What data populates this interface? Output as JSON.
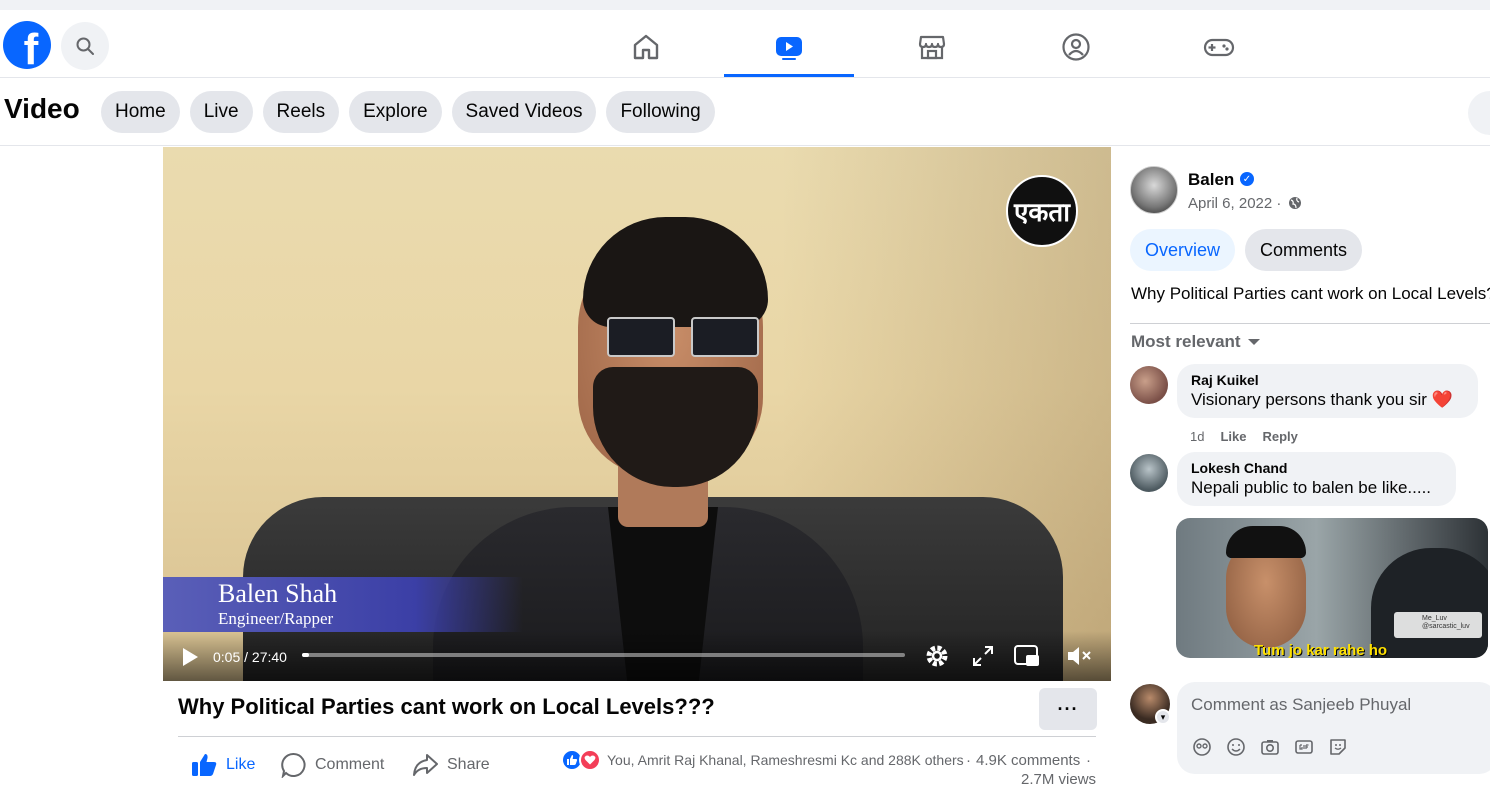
{
  "nav": {
    "logo": "f",
    "icons": [
      "home-icon",
      "video-icon",
      "marketplace-icon",
      "groups-icon",
      "gaming-icon"
    ],
    "active": "video-icon"
  },
  "subnav": {
    "title": "Video",
    "pills": [
      "Home",
      "Live",
      "Reels",
      "Explore",
      "Saved Videos",
      "Following"
    ]
  },
  "video": {
    "logo_text": "एकता",
    "lower_third_name": "Balen Shah",
    "lower_third_role": "Engineer/Rapper",
    "time": "0:05 / 27:40",
    "progress": 0.012
  },
  "post": {
    "title": "Why Political Parties cant work on Local Levels???",
    "more": "···",
    "actions": {
      "like": "Like",
      "comment": "Comment",
      "share": "Share"
    },
    "reactions_text": "You, Amrit Raj Khanal, Rameshresmi Kc and 288K others",
    "comments_count": "4.9K comments",
    "views": "2.7M views",
    "sep": "·"
  },
  "side": {
    "author": "Balen",
    "date": "April 6, 2022 ·",
    "tabs": {
      "overview": "Overview",
      "comments": "Comments"
    },
    "description": "Why Political Parties cant work on Local Levels???",
    "sort": "Most relevant",
    "comments": [
      {
        "name": "Raj Kuikel",
        "text": "Visionary persons thank you sir ❤️",
        "time": "1d",
        "like": "Like",
        "reply": "Reply"
      },
      {
        "name": "Lokesh Chand",
        "text": "Nepali public to balen be like....."
      }
    ],
    "meme": {
      "subtitle": "Tum jo kar rahe ho",
      "watermark_name": "Me_Luv",
      "watermark_handle": "@sarcastic_luv"
    },
    "comment_placeholder": "Comment as Sanjeeb Phuyal"
  },
  "colors": {
    "accent": "#0866ff",
    "heart": "#f33e58"
  }
}
